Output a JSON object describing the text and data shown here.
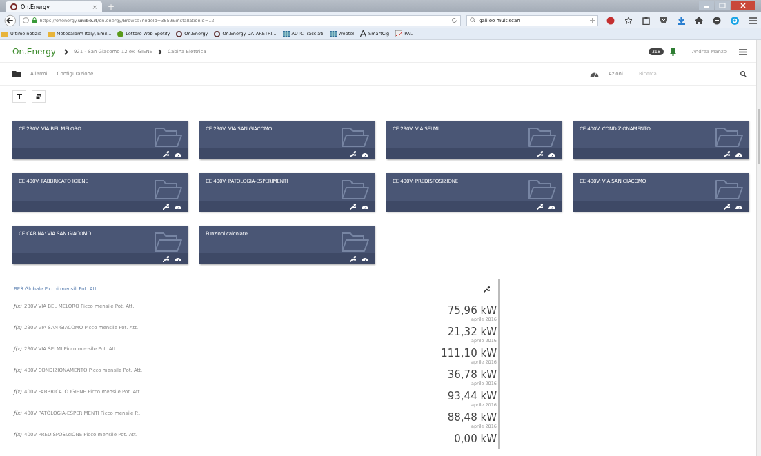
{
  "browser": {
    "tab": {
      "title": "On.Energy",
      "close": "×",
      "new_tab": "+"
    },
    "url": "https://onenergy.**unibo.it**/on.energy/Browse?nodeId=3659&installationId=13",
    "search": {
      "value": "galileo multiscan"
    },
    "bookmarks": [
      {
        "label": "Ultime notizie",
        "kind": "folder"
      },
      {
        "label": "Meteoalarm Italy, Emil...",
        "kind": "folder"
      },
      {
        "label": "Lettore Web Spotify",
        "kind": "spotify"
      },
      {
        "label": "On.Energy",
        "kind": "site"
      },
      {
        "label": "On.Energy DATARETRI...",
        "kind": "site"
      },
      {
        "label": "AUTC-Tracciati",
        "kind": "grid"
      },
      {
        "label": "Webtel",
        "kind": "grid"
      },
      {
        "label": "SmartCig",
        "kind": "letter"
      },
      {
        "label": "PAL",
        "kind": "chart"
      }
    ]
  },
  "header": {
    "brand": "On.Energy",
    "breadcrumb": [
      "921 - San Giacomo 12 ex IGIENE",
      "Cabina Elettrica"
    ],
    "badge": "318",
    "user": "Andrea Manzo"
  },
  "menu": {
    "items": [
      "Allarmi",
      "Configurazione"
    ],
    "actions": "Azioni",
    "search": {
      "placeholder": "Ricerca ..."
    }
  },
  "cards": [
    {
      "title": "CE 230V: VIA BEL MELORO"
    },
    {
      "title": "CE 230V: VIA SAN GIACOMO"
    },
    {
      "title": "CE 230V: VIA SELMI"
    },
    {
      "title": "CE 400V: CONDIZIONAMENTO"
    },
    {
      "title": "CE 400V: FABBRICATO IGIENE"
    },
    {
      "title": "CE 400V: PATOLOGIA-ESPERIMENTI"
    },
    {
      "title": "CE 400V: PREDISPOSIZIONE"
    },
    {
      "title": "CE 400V: VIA SAN GIACOMO"
    },
    {
      "title": "CE CABINA: VIA SAN GIACOMO"
    },
    {
      "title": "Funzioni calcolate"
    }
  ],
  "widget": {
    "title": "BES Globale Picchi mensili Pot. Att.",
    "rows": [
      {
        "prefix": "ƒ(x)",
        "label": "230V VIA BEL MELORO Picco mensile Pot. Att.",
        "value": "75,96 kW",
        "date": "aprile 2016"
      },
      {
        "prefix": "ƒ(x)",
        "label": "230V VIA SAN GIACOMO Picco mensile Pot. Att.",
        "value": "21,32 kW",
        "date": "aprile 2016"
      },
      {
        "prefix": "ƒ(x)",
        "label": "230V VIA SELMI Picco mensile Pot. Att.",
        "value": "111,10 kW",
        "date": "aprile 2016"
      },
      {
        "prefix": "ƒ(x)",
        "label": "400V CONDIZIONAMENTO Picco mensile Pot. Att.",
        "value": "36,78 kW",
        "date": "aprile 2016"
      },
      {
        "prefix": "ƒ(x)",
        "label": "400V FABBRICATO IGIENE Picco mensile Pot. Att.",
        "value": "93,44 kW",
        "date": "aprile 2016"
      },
      {
        "prefix": "ƒ(x)",
        "label": "400V PATOLOGIA-ESPERIMENTI Picco mensile P...",
        "value": "88,48 kW",
        "date": "aprile 2016"
      },
      {
        "prefix": "ƒ(x)",
        "label": "400V PREDISPOSIZIONE Picco mensile Pot. Att.",
        "value": "0,00 kW"
      }
    ]
  }
}
